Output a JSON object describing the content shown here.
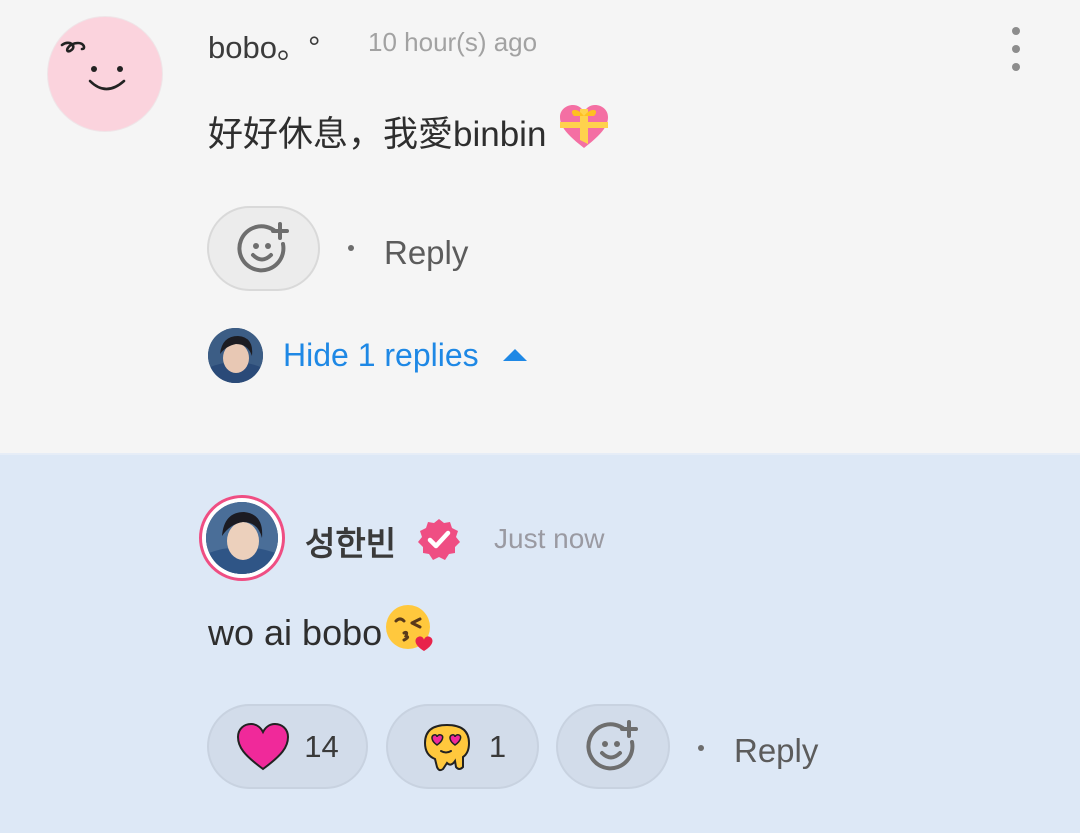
{
  "comment": {
    "username": "bobo。°",
    "timestamp": "10 hour(s) ago",
    "text": "好好休息，我愛binbin",
    "emoji": "💝",
    "reply_label": "Reply",
    "hide_replies_label": "Hide 1 replies"
  },
  "reply": {
    "username": "성한빈",
    "timestamp": "Just now",
    "text": "wo ai bobo",
    "emoji": "😘",
    "reactions": [
      {
        "icon": "heart-icon",
        "count": "14",
        "color": "#f0299a"
      },
      {
        "icon": "melting-heart-eyes-icon",
        "count": "1",
        "color": "#ffc83d"
      }
    ],
    "reply_label": "Reply"
  },
  "colors": {
    "accent_blue": "#1e88e5",
    "verified_pink": "#ef4e83",
    "reply_background": "#dde8f6",
    "comment_background": "#f5f5f5"
  }
}
